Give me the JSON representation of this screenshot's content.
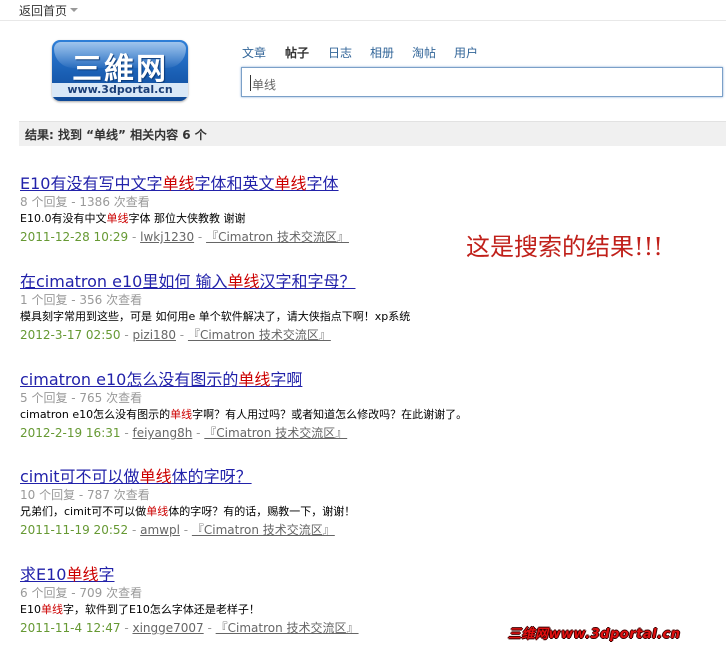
{
  "topbar": {
    "back_label": "返回首页"
  },
  "logo": {
    "cn": "三維网",
    "url": "www.3dportal.cn"
  },
  "tabs": [
    "文章",
    "帖子",
    "日志",
    "相册",
    "淘帖",
    "用户"
  ],
  "search": {
    "value": "单线"
  },
  "result_summary": "结果: 找到 “单线” 相关内容 6 个",
  "results": [
    {
      "title_parts": [
        "E10有没有写中文字",
        "单线",
        "字体和英文",
        "单线",
        "字体"
      ],
      "meta": "8 个回复 - 1386 次查看",
      "desc_parts": [
        "E10.0有没有中文",
        "单线",
        "字体 那位大侠教教 谢谢"
      ],
      "date": "2011-12-28 10:29",
      "author": "lwkj1230",
      "forum": "『Cimatron 技术交流区』"
    },
    {
      "title_parts": [
        "在cimatron e10里如何 输入",
        "单线",
        "汉字和字母？"
      ],
      "meta": "1 个回复 - 356 次查看",
      "desc_parts": [
        "模具刻字常用到这些，可是 如何用e 单个软件解决了，请大侠指点下啊！xp系统"
      ],
      "date": "2012-3-17 02:50",
      "author": "pizi180",
      "forum": "『Cimatron 技术交流区』"
    },
    {
      "title_parts": [
        "cimatron e10怎么没有图示的",
        "单线",
        "字啊"
      ],
      "meta": "5 个回复 - 765 次查看",
      "desc_parts": [
        "cimatron e10怎么没有图示的",
        "单线",
        "字啊？有人用过吗？或者知道怎么修改吗？在此谢谢了。"
      ],
      "date": "2012-2-19 16:31",
      "author": "feiyang8h",
      "forum": "『Cimatron 技术交流区』"
    },
    {
      "title_parts": [
        "cimit可不可以做",
        "单线",
        "体的字呀？"
      ],
      "meta": "10 个回复 - 787 次查看",
      "desc_parts": [
        "兄弟们，cimit可不可以做",
        "单线",
        "体的字呀？有的话，赐教一下，谢谢！"
      ],
      "date": "2011-11-19 20:52",
      "author": "amwpl",
      "forum": "『Cimatron 技术交流区』"
    },
    {
      "title_parts": [
        "求E10",
        "单线",
        "字"
      ],
      "meta": "6 个回复 - 709 次查看",
      "desc_parts": [
        "E10",
        "单线",
        "字，软件到了E10怎么字体还是老样子！"
      ],
      "date": "2011-11-4 12:47",
      "author": "xingge7007",
      "forum": "『Cimatron 技术交流区』"
    }
  ],
  "annotation": "这是搜索的结果!!!",
  "watermark": "三维网www.3dportal.cn",
  "colors": {
    "link": "#2222aa",
    "highlight": "#cc0000",
    "date": "#669933",
    "annotation": "#c0201a"
  }
}
